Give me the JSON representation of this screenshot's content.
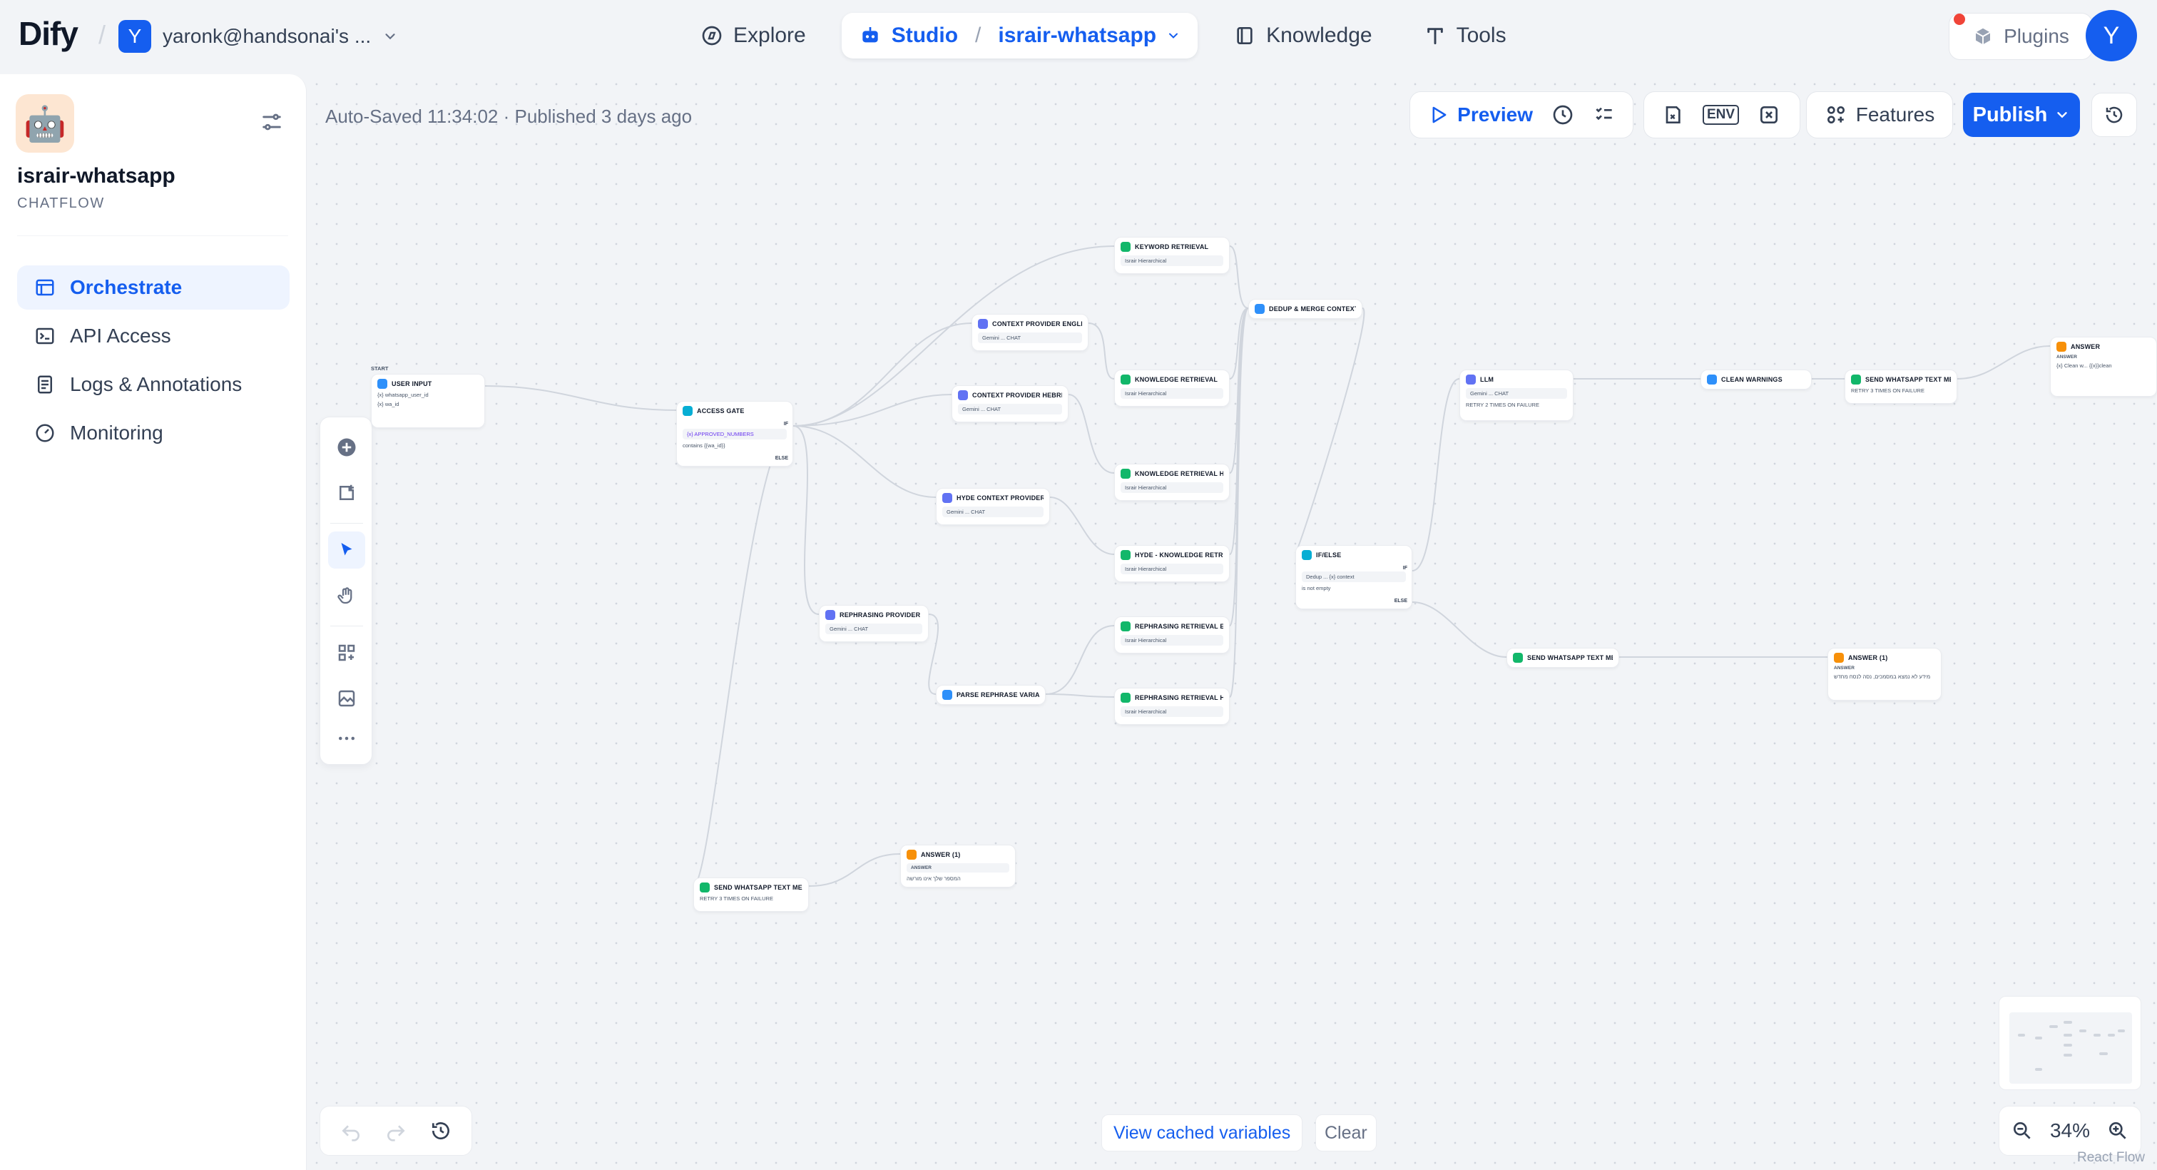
{
  "brand": {
    "logo_text": "Dify"
  },
  "workspace": {
    "initial": "Y",
    "name": "yaronk@handsonai's ..."
  },
  "nav": {
    "explore": "Explore",
    "studio": "Studio",
    "studio_app": "israir-whatsapp",
    "knowledge": "Knowledge",
    "tools": "Tools",
    "plugins": "Plugins",
    "user_initial": "Y"
  },
  "app": {
    "icon": "🤖",
    "name": "israir-whatsapp",
    "type": "CHATFLOW"
  },
  "sidebar": {
    "items": [
      {
        "label": "Orchestrate",
        "icon": "orchestrate-icon",
        "active": true
      },
      {
        "label": "API Access",
        "icon": "terminal-icon",
        "active": false
      },
      {
        "label": "Logs & Annotations",
        "icon": "logs-icon",
        "active": false
      },
      {
        "label": "Monitoring",
        "icon": "monitoring-icon",
        "active": false
      }
    ]
  },
  "toolbar": {
    "status": "Auto-Saved 11:34:02 · Published 3 days ago",
    "preview": "Preview",
    "env": "ENV",
    "features": "Features",
    "publish": "Publish"
  },
  "nodes": {
    "start_tag": "START",
    "user_input": {
      "title": "USER INPUT",
      "v1": "{x} whatsapp_user_id",
      "v2": "{x} wa_id"
    },
    "access_gate": {
      "title": "ACCESS GATE",
      "if": "IF",
      "cond_var": "{x} APPROVED_NUMBERS",
      "cond": "contains  {{wa_id}}",
      "else": "ELSE"
    },
    "keyword_retrieval": {
      "title": "KEYWORD RETRIEVAL",
      "kb": "Israir Hierarchical"
    },
    "ctx_english": {
      "title": "CONTEXT PROVIDER ENGLI",
      "model": "Gemini ...  CHAT"
    },
    "ctx_hebrew": {
      "title": "CONTEXT PROVIDER HEBRE",
      "model": "Gemini ...  CHAT"
    },
    "knowledge_retrieval": {
      "title": "KNOWLEDGE RETRIEVAL",
      "kb": "Israir Hierarchical"
    },
    "knowledge_retrieval_he": {
      "title": "KNOWLEDGE RETRIEVAL HE",
      "kb": "Israir Hierarchical"
    },
    "hyde_ctx": {
      "title": "HYDE CONTEXT PROVIDER",
      "model": "Gemini ...  CHAT"
    },
    "hyde_kr": {
      "title": "HYDE - KNOWLEDGE RETRI",
      "kb": "Israir Hierarchical"
    },
    "rephrasing_provider": {
      "title": "REPHRASING PROVIDER",
      "model": "Gemini ...  CHAT"
    },
    "parse_rephrase": {
      "title": "PARSE REPHRASE VARIANT"
    },
    "rephrasing_en": {
      "title": "REPHRASING RETRIEVAL EN",
      "kb": "Israir Hierarchical"
    },
    "rephrasing_he": {
      "title": "REPHRASING RETRIEVAL HE",
      "kb": "Israir Hierarchical"
    },
    "dedup": {
      "title": "DEDUP & MERGE CONTEXT"
    },
    "ifelse": {
      "title": "IF/ELSE",
      "if": "IF",
      "cond_var": "Dedup ...  {x} context",
      "cond": "is not empty",
      "else": "ELSE"
    },
    "llm": {
      "title": "LLM",
      "model": "Gemini ...  CHAT",
      "retry": "RETRY 2 TIMES ON FAILURE"
    },
    "clean_warnings": {
      "title": "CLEAN WARNINGS"
    },
    "send_wa_1": {
      "title": "SEND WHATSAPP TEXT MES",
      "retry": "RETRY 3 TIMES ON FAILURE"
    },
    "answer": {
      "title": "ANSWER",
      "label": "ANSWER",
      "text": "{x} Clean w...  {{x}}clean"
    },
    "send_wa_2": {
      "title": "SEND WHATSAPP TEXT MES"
    },
    "answer_1": {
      "title": "ANSWER (1)",
      "label": "ANSWER",
      "text": "מידע לא נמצא במסמכים, נסה לנסח מחדש"
    },
    "send_wa_3": {
      "title": "SEND WHATSAPP TEXT MES",
      "retry": "RETRY 3 TIMES ON FAILURE"
    },
    "answer_1b": {
      "title": "ANSWER (1)",
      "label": "ANSWER",
      "text": "המספר שלך אינו מורשה"
    }
  },
  "bottom": {
    "view_cached": "View cached variables",
    "clear": "Clear",
    "zoom": "34%",
    "attribution": "React Flow"
  },
  "colors": {
    "accent": "#155eef",
    "llm_node": "#6172f3",
    "retrieval_node": "#12b76a",
    "answer_node": "#f79009",
    "logic_node": "#06aed4"
  }
}
